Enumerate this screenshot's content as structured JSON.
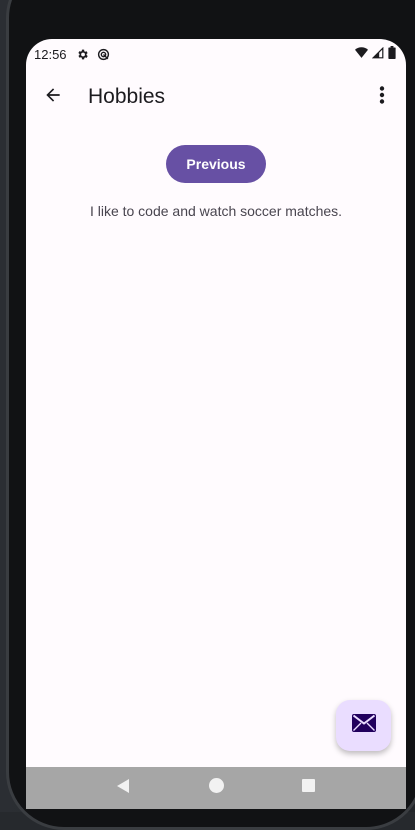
{
  "status_bar": {
    "time": "12:56",
    "icons_left": [
      "settings-icon",
      "sync-icon"
    ],
    "icons_right": [
      "wifi-icon",
      "cell-signal-icon",
      "battery-icon"
    ]
  },
  "app_bar": {
    "title": "Hobbies",
    "back_icon": "arrow-back-icon",
    "menu_icon": "more-vert-icon"
  },
  "main": {
    "previous_button_label": "Previous",
    "hobby_text": "I like to code and watch soccer matches."
  },
  "fab": {
    "icon": "mail-icon"
  },
  "nav_bar": {
    "buttons": [
      "back-triangle-icon",
      "home-circle-icon",
      "recents-square-icon"
    ]
  },
  "colors": {
    "primary": "#6750a4",
    "fab_background": "#eaddff",
    "surface": "#fffbfe",
    "nav_bar": "#a6a6a6"
  }
}
